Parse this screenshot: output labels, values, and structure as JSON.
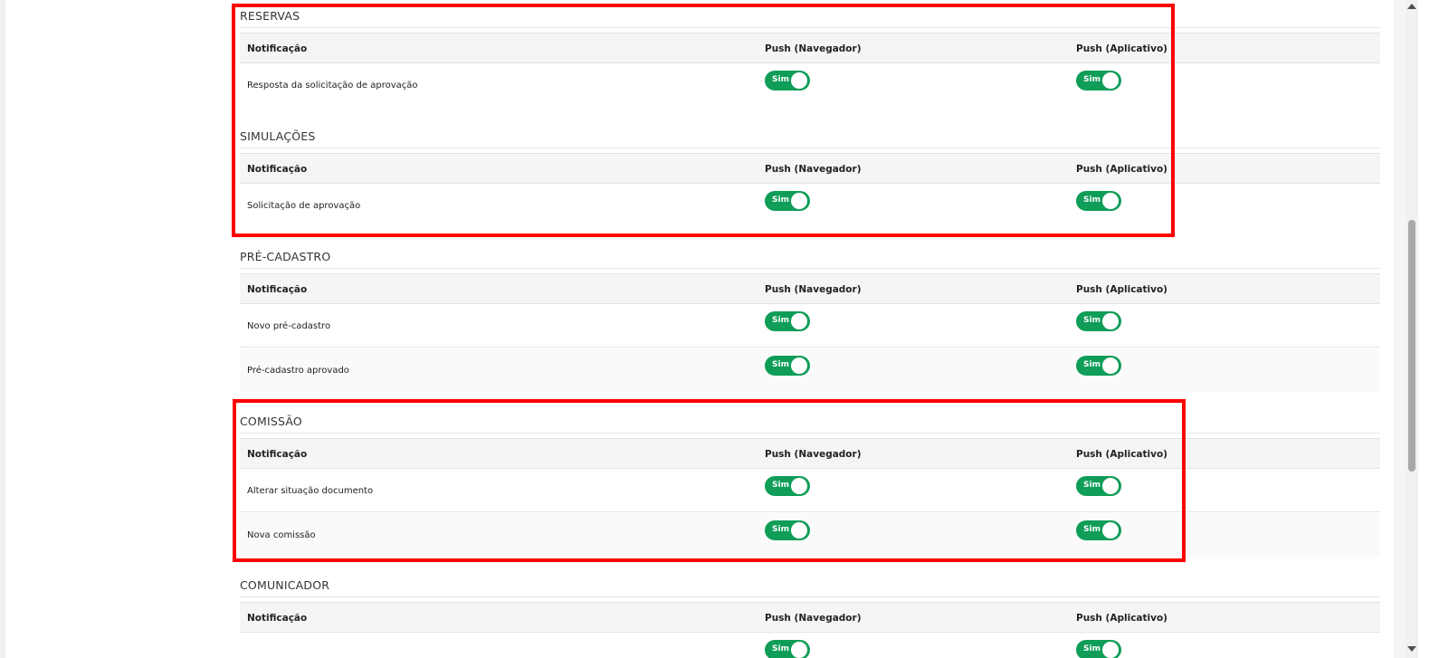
{
  "columns": {
    "notification": "Notificação",
    "push_browser": "Push (Navegador)",
    "push_app": "Push (Aplicativo)"
  },
  "toggle_on_label": "Sim",
  "colors": {
    "toggle_on": "#0f9d58",
    "highlight": "#ff0000"
  },
  "sections": [
    {
      "title": "RESERVAS",
      "rows": [
        {
          "label": "Resposta da solicitação de aprovação",
          "push_browser": "on",
          "push_app": "on"
        }
      ]
    },
    {
      "title": "SIMULAÇÕES",
      "rows": [
        {
          "label": "Solicitação de aprovação",
          "push_browser": "on",
          "push_app": "on"
        }
      ]
    },
    {
      "title": "PRÉ-CADASTRO",
      "rows": [
        {
          "label": "Novo pré-cadastro",
          "push_browser": "on",
          "push_app": "on"
        },
        {
          "label": "Pré-cadastro aprovado",
          "push_browser": "on",
          "push_app": "on"
        }
      ]
    },
    {
      "title": "COMISSÃO",
      "rows": [
        {
          "label": "Alterar situação documento",
          "push_browser": "on",
          "push_app": "on"
        },
        {
          "label": "Nova comissão",
          "push_browser": "on",
          "push_app": "on"
        }
      ]
    },
    {
      "title": "COMUNICADOR",
      "rows": [
        {
          "label": "",
          "push_browser": "on",
          "push_app": "on"
        }
      ]
    }
  ]
}
